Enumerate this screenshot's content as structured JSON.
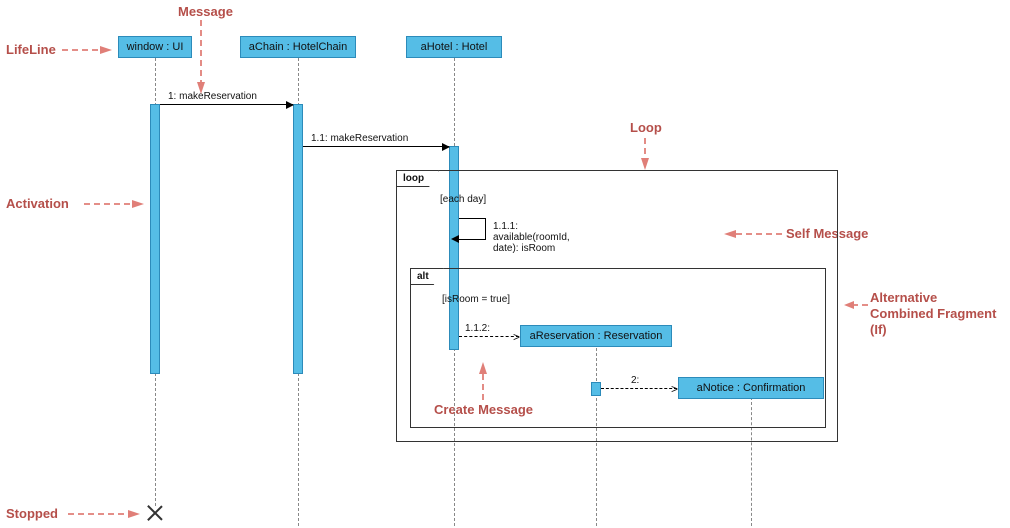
{
  "annotations": {
    "message": "Message",
    "lifeline": "LifeLine",
    "activation": "Activation",
    "stopped": "Stopped",
    "loop": "Loop",
    "self_message": "Self Message",
    "alt_line1": "Alternative",
    "alt_line2": "Combined Fragment",
    "alt_line3": "(If)",
    "create_message": "Create Message"
  },
  "lifelines": {
    "window": "window : UI",
    "chain": "aChain : HotelChain",
    "hotel": "aHotel : Hotel",
    "reservation": "aReservation : Reservation",
    "notice": "aNotice : Confirmation"
  },
  "frags": {
    "loop": "loop",
    "loop_guard": "[each day]",
    "alt": "alt",
    "alt_guard": "[isRoom = true]"
  },
  "msgs": {
    "m1": "1: makeReservation",
    "m11": "1.1: makeReservation",
    "m111": "1.1.1: available(roomId, date): isRoom",
    "m112": "1.1.2:",
    "m2": "2:"
  },
  "chart_data": {
    "type": "sequence_diagram",
    "lifelines": [
      {
        "id": "window",
        "label": "window : UI"
      },
      {
        "id": "chain",
        "label": "aChain : HotelChain"
      },
      {
        "id": "hotel",
        "label": "aHotel : Hotel"
      },
      {
        "id": "reservation",
        "label": "aReservation : Reservation",
        "created_by": "1.1.2"
      },
      {
        "id": "notice",
        "label": "aNotice : Confirmation",
        "created_by": "2"
      }
    ],
    "messages": [
      {
        "seq": "1",
        "from": "window",
        "to": "chain",
        "label": "makeReservation",
        "kind": "sync"
      },
      {
        "seq": "1.1",
        "from": "chain",
        "to": "hotel",
        "label": "makeReservation",
        "kind": "sync"
      },
      {
        "seq": "1.1.1",
        "from": "hotel",
        "to": "hotel",
        "label": "available(roomId, date): isRoom",
        "kind": "self"
      },
      {
        "seq": "1.1.2",
        "from": "hotel",
        "to": "reservation",
        "label": "",
        "kind": "create"
      },
      {
        "seq": "2",
        "from": "reservation",
        "to": "notice",
        "label": "",
        "kind": "create"
      }
    ],
    "fragments": [
      {
        "type": "loop",
        "guard": "[each day]",
        "contains": [
          "1.1.1",
          "alt"
        ]
      },
      {
        "type": "alt",
        "guard": "[isRoom = true]",
        "contains": [
          "1.1.2",
          "2"
        ]
      }
    ],
    "stopped": [
      "window"
    ]
  }
}
